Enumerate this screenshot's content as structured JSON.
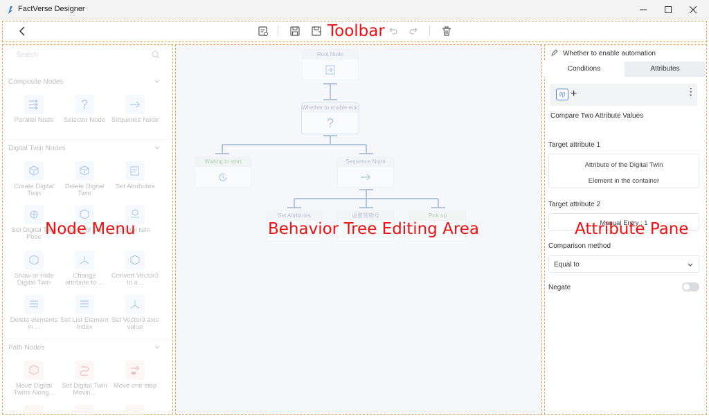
{
  "window": {
    "title": "FactVerse Designer"
  },
  "overlay_labels": {
    "toolbar": "Toolbar",
    "node_menu": "Node Menu",
    "canvas": "Behavior Tree Editing Area",
    "attribute_pane": "Attribute Pane"
  },
  "node_menu": {
    "search_placeholder": "Search",
    "sections": [
      {
        "title": "Composite Nodes",
        "items": [
          "Parallel Node",
          "Selector Node",
          "Sequence Node"
        ]
      },
      {
        "title": "Digital Twin Nodes",
        "items": [
          "Create Digital Twin",
          "Delete Digital Twin",
          "Set Attributes",
          "Set Digital Twin Pose",
          "object of digi",
          "digital twin",
          "Show or Hide Digital Twin",
          "Change attribute to ...",
          "Convert Vector3 to a...",
          "Delete elements in ...",
          "Set List Element Index",
          "Set Vector3 axis value"
        ]
      },
      {
        "title": "Path Nodes",
        "items": [
          "Move Digital Twins Along...",
          "Set Digital Twin Movin...",
          "Move one step"
        ]
      }
    ]
  },
  "canvas": {
    "nodes": {
      "root": "Root Node",
      "condition": "Whether to enable auto",
      "waiting": "Waiting to start",
      "sequence": "Sequence Node",
      "set_attributes": "Set Attributes",
      "set_cargo": "设置货物号",
      "pick_up": "Pick up"
    }
  },
  "attribute_pane": {
    "header": "Whether to enable automation",
    "tabs": [
      "Conditions",
      "Attributes"
    ],
    "condition_chip": "if()",
    "condition_type": "Compare Two Attribute Values",
    "target1_label": "Target attribute 1",
    "target1_lines": [
      "Attribute of the Digital Twin",
      "Element in the container"
    ],
    "target2_label": "Target attribute 2",
    "target2_value": "Manual Entry : 1",
    "comparison_label": "Comparison method",
    "comparison_value": "Equal to",
    "negate_label": "Negate",
    "negate_on": false
  }
}
